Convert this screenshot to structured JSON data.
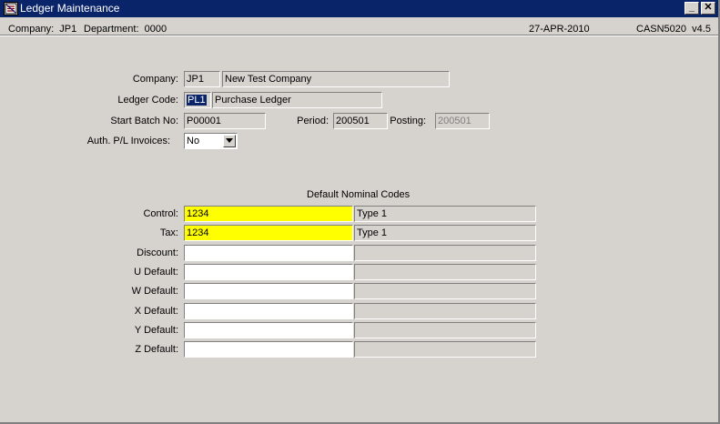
{
  "window": {
    "title": "Ledger Maintenance",
    "minimize_label": "_",
    "close_label": "✕"
  },
  "statusbar": {
    "company": "Company:  JP1",
    "department": "Department:  0000",
    "date": "27-APR-2010",
    "version": "CASN5020  v4.5"
  },
  "form": {
    "company_label": "Company:",
    "company_code": "JP1",
    "company_name": "New Test Company",
    "ledger_label": "Ledger Code:",
    "ledger_code": "PL1",
    "ledger_name": "Purchase Ledger",
    "start_batch_label": "Start Batch No:",
    "start_batch_value": "P00001",
    "period_label": "Period:",
    "period_value": "200501",
    "posting_label": "Posting:",
    "posting_value": "200501",
    "auth_label": "Auth. P/L  Invoices:",
    "auth_value": "No"
  },
  "nominal": {
    "title": "Default Nominal Codes",
    "rows": [
      {
        "label": "Control:",
        "code": "1234",
        "desc": "Type 1"
      },
      {
        "label": "Tax:",
        "code": "1234",
        "desc": "Type 1"
      },
      {
        "label": "Discount:",
        "code": "",
        "desc": ""
      },
      {
        "label": "U Default:",
        "code": "",
        "desc": ""
      },
      {
        "label": "W Default:",
        "code": "",
        "desc": ""
      },
      {
        "label": "X Default:",
        "code": "",
        "desc": ""
      },
      {
        "label": "Y Default:",
        "code": "",
        "desc": ""
      },
      {
        "label": "Z Default:",
        "code": "",
        "desc": ""
      }
    ]
  },
  "colors": {
    "titlebar": "#0a246a",
    "highlight_field": "#ffff00",
    "selection": "#0a246a"
  }
}
